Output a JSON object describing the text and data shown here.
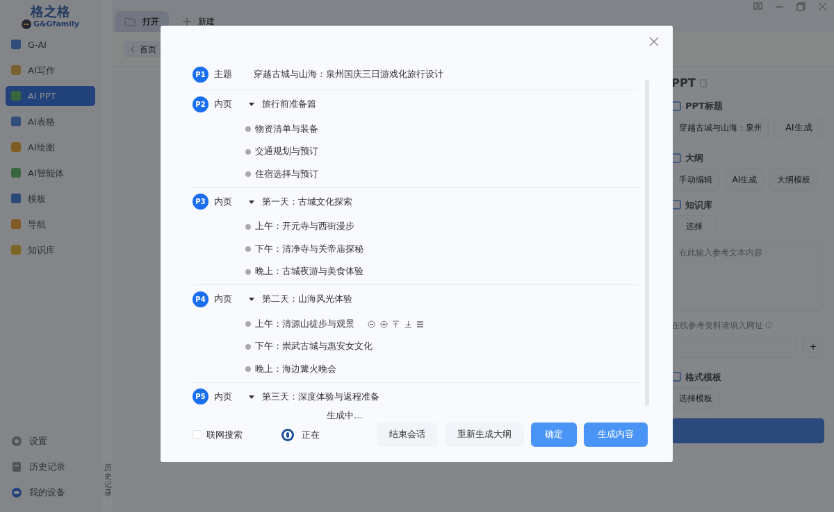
{
  "sidebar": {
    "logo": {
      "title": "格之格",
      "subtitle": "G&Gfamily"
    },
    "items": [
      {
        "label": "G-AI",
        "selected": false
      },
      {
        "label": "AI写作",
        "selected": false
      },
      {
        "label": "AI PPT",
        "selected": true
      },
      {
        "label": "AI表格",
        "selected": false
      },
      {
        "label": "AI绘图",
        "selected": false
      },
      {
        "label": "AI智能体",
        "selected": false
      },
      {
        "label": "模板",
        "selected": false
      },
      {
        "label": "导航",
        "selected": false
      },
      {
        "label": "知识库",
        "selected": false
      }
    ],
    "bottom_items": [
      {
        "label": "设置",
        "kind": "gear"
      },
      {
        "label": "历史记录",
        "kind": "history"
      },
      {
        "label": "我的设备",
        "kind": "device"
      }
    ]
  },
  "history_tab": "历史记录",
  "tabs": [
    {
      "label": "打开",
      "selected": true
    },
    {
      "label": "新建",
      "selected": false
    }
  ],
  "breadcrumb": "首页",
  "right_panel": {
    "title": "PPT",
    "title_label": "PPT标题",
    "title_value": "穿越古城与山海：泉州",
    "title_button": "AI生成",
    "outline_label": "大纲",
    "outline_buttons": [
      "手动编辑",
      "AI生成",
      "大纲模板"
    ],
    "knowledge_label": "知识库",
    "select_button": "选择",
    "reference_placeholder": "在此输入参考文本内容",
    "url_label": "在线参考资料请填入网址",
    "add_button": "+",
    "format_label": "格式模板",
    "format_button": "选择模板"
  },
  "dialog": {
    "pages": [
      {
        "badge": "P1",
        "type": "主题",
        "kind": "cover",
        "title": "穿越古城与山海：泉州国庆三日游戏化旅行设计"
      },
      {
        "badge": "P2",
        "type": "内页",
        "kind": "section",
        "title": "旅行前准备篇",
        "expanded": true,
        "items": [
          {
            "text": "物资清单与装备",
            "show_actions": false
          },
          {
            "text": "交通规划与预订",
            "show_actions": false
          },
          {
            "text": "住宿选择与预订",
            "show_actions": false
          }
        ]
      },
      {
        "badge": "P3",
        "type": "内页",
        "kind": "section",
        "title": "第一天：古城文化探索",
        "expanded": true,
        "items": [
          {
            "text": "上午：开元寺与西街漫步",
            "show_actions": false
          },
          {
            "text": "下午：清净寺与关帝庙探秘",
            "show_actions": false
          },
          {
            "text": "晚上：古城夜游与美食体验",
            "show_actions": false
          }
        ]
      },
      {
        "badge": "P4",
        "type": "内页",
        "kind": "section",
        "title": "第二天：山海风光体验",
        "expanded": true,
        "items": [
          {
            "text": "上午：清源山徒步与观景",
            "show_actions": true
          },
          {
            "text": "下午：崇武古城与惠安女文化",
            "show_actions": false
          },
          {
            "text": "晚上：海边篝火晚会",
            "show_actions": false
          }
        ]
      },
      {
        "badge": "P5",
        "type": "内页",
        "kind": "section",
        "title": "第三天：深度体验与返程准备",
        "expanded": true
      }
    ],
    "web_search": {
      "label": "联网搜索",
      "checked": false
    },
    "status": [
      "正在",
      "生成中…"
    ],
    "buttons": [
      {
        "label": "结束会话",
        "kind": "secondary"
      },
      {
        "label": "重新生成大纲",
        "kind": "secondary"
      },
      {
        "label": "确定",
        "kind": "primary"
      },
      {
        "label": "生成内容",
        "kind": "primary"
      }
    ]
  }
}
